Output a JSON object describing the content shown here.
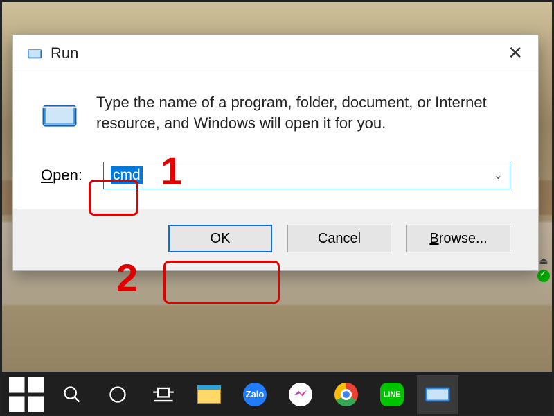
{
  "dialog": {
    "title": "Run",
    "description": "Type the name of a program, folder, document, or Internet resource, and Windows will open it for you.",
    "open_label": "Open:",
    "open_underline_char": "O",
    "input_value": "cmd",
    "buttons": {
      "ok": "OK",
      "cancel": "Cancel",
      "browse": "Browse...",
      "browse_underline_char": "B"
    }
  },
  "annotations": {
    "step1": "1",
    "step2": "2"
  },
  "taskbar": {
    "items": [
      {
        "name": "start",
        "label": "Start"
      },
      {
        "name": "search",
        "label": "Search"
      },
      {
        "name": "cortana",
        "label": "Cortana"
      },
      {
        "name": "task-view",
        "label": "Task View"
      },
      {
        "name": "file-explorer",
        "label": "File Explorer"
      },
      {
        "name": "zalo",
        "label": "Zalo"
      },
      {
        "name": "messenger",
        "label": "Messenger"
      },
      {
        "name": "chrome",
        "label": "Google Chrome"
      },
      {
        "name": "line",
        "label": "LINE"
      },
      {
        "name": "run",
        "label": "Run"
      }
    ],
    "zalo_text": "Zalo",
    "line_text": "LINE"
  }
}
